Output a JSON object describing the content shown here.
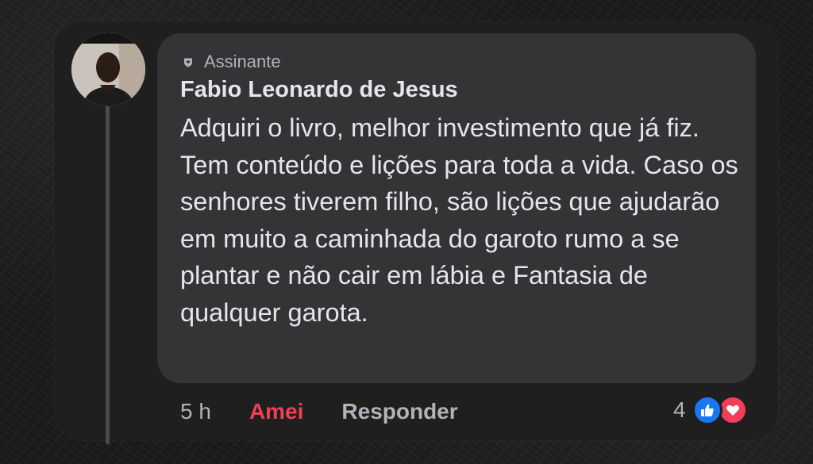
{
  "comment": {
    "badge": {
      "icon": "subscriber-badge-icon",
      "label": "Assinante"
    },
    "author": "Fabio Leonardo de Jesus",
    "text": "Adquiri o livro, melhor investimento que já fiz. Tem conteúdo e lições para toda a vida. Caso os senhores tiverem filho, são lições que ajudarão em muito a caminhada do garoto rumo a se plantar e não cair em lábia e Fantasia de qualquer garota."
  },
  "actions": {
    "timestamp": "5 h",
    "love_label": "Amei",
    "reply_label": "Responder"
  },
  "reactions": {
    "count": "4",
    "icons": [
      "like-icon",
      "love-icon"
    ]
  },
  "colors": {
    "bubble": "#343436",
    "card": "#1f1f20",
    "text_primary": "#e4e6eb",
    "text_secondary": "#b0b3b8",
    "love_red": "#f33e58",
    "like_blue": "#1877f2"
  }
}
